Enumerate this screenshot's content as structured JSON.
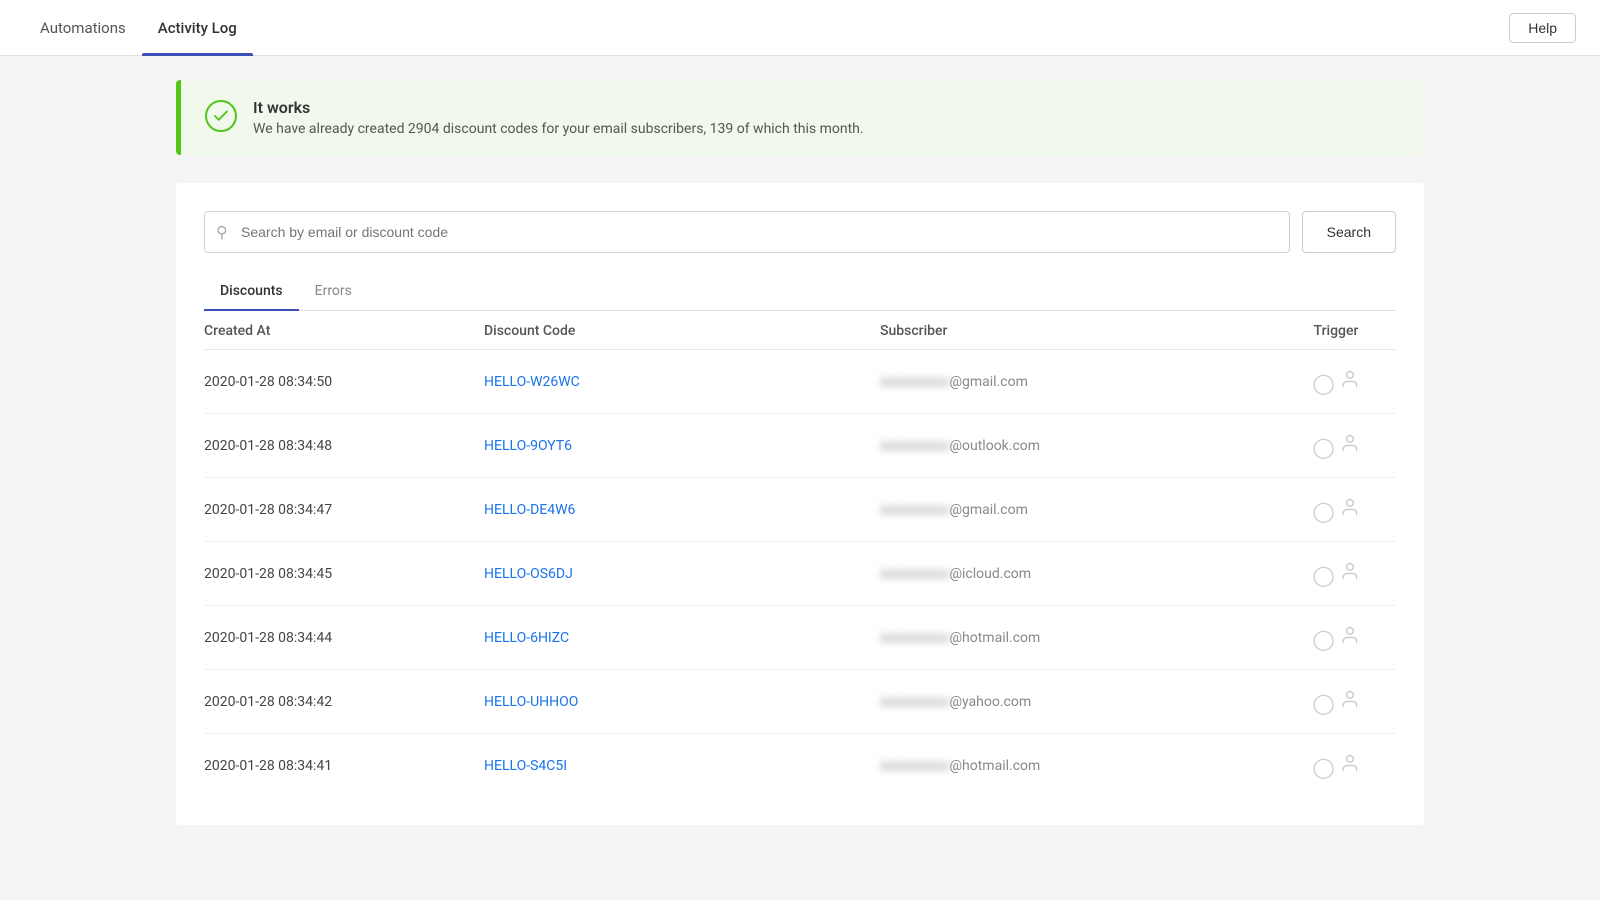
{
  "nav": {
    "items": [
      {
        "id": "automations",
        "label": "Automations",
        "active": false
      },
      {
        "id": "activity-log",
        "label": "Activity Log",
        "active": true
      }
    ],
    "help_label": "Help"
  },
  "banner": {
    "title": "It works",
    "body": "We have already created 2904 discount codes for your email subscribers, 139 of which this month."
  },
  "search": {
    "placeholder": "Search by email or discount code",
    "button_label": "Search"
  },
  "tabs": [
    {
      "id": "discounts",
      "label": "Discounts",
      "active": true
    },
    {
      "id": "errors",
      "label": "Errors",
      "active": false
    }
  ],
  "table": {
    "columns": [
      {
        "id": "created_at",
        "label": "Created At"
      },
      {
        "id": "discount_code",
        "label": "Discount Code"
      },
      {
        "id": "subscriber",
        "label": "Subscriber"
      },
      {
        "id": "trigger",
        "label": "Trigger"
      }
    ],
    "rows": [
      {
        "created_at": "2020-01-28 08:34:50",
        "discount_code": "HELLO-W26WC",
        "subscriber_prefix": "redacted",
        "subscriber_domain": "@gmail.com"
      },
      {
        "created_at": "2020-01-28 08:34:48",
        "discount_code": "HELLO-9OYT6",
        "subscriber_prefix": "redacted",
        "subscriber_domain": "@outlook.com"
      },
      {
        "created_at": "2020-01-28 08:34:47",
        "discount_code": "HELLO-DE4W6",
        "subscriber_prefix": "redacted",
        "subscriber_domain": "@gmail.com"
      },
      {
        "created_at": "2020-01-28 08:34:45",
        "discount_code": "HELLO-OS6DJ",
        "subscriber_prefix": "redacted",
        "subscriber_domain": "@icloud.com"
      },
      {
        "created_at": "2020-01-28 08:34:44",
        "discount_code": "HELLO-6HIZC",
        "subscriber_prefix": "redacted",
        "subscriber_domain": "@hotmail.com"
      },
      {
        "created_at": "2020-01-28 08:34:42",
        "discount_code": "HELLO-UHHOO",
        "subscriber_prefix": "redacted",
        "subscriber_domain": "@yahoo.com"
      },
      {
        "created_at": "2020-01-28 08:34:41",
        "discount_code": "HELLO-S4C5I",
        "subscriber_prefix": "redacted",
        "subscriber_domain": "@hotmail.com"
      }
    ]
  }
}
